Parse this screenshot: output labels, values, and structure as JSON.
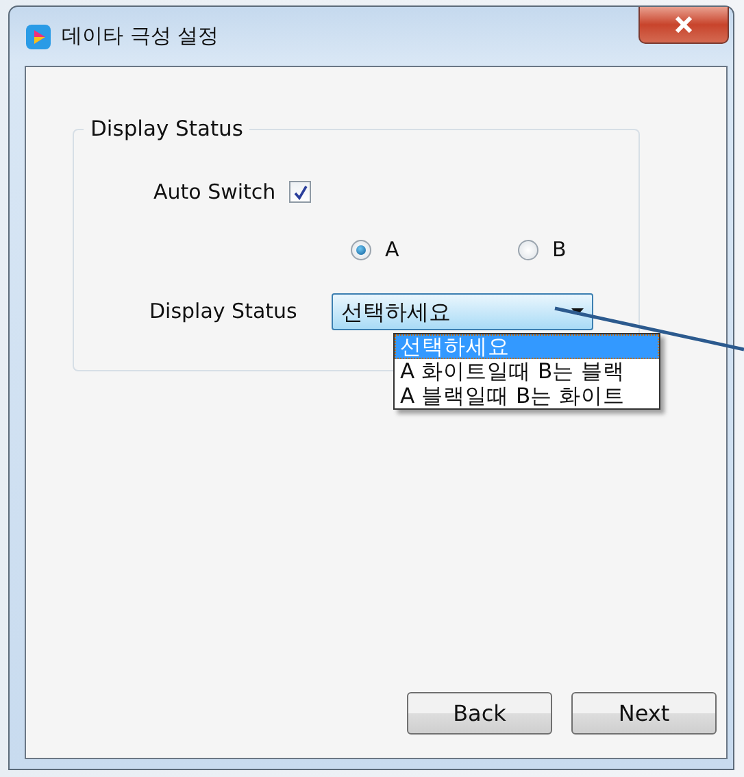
{
  "window": {
    "title": "데이타 극성 설정"
  },
  "group": {
    "title": "Display Status"
  },
  "auto_switch": {
    "label": "Auto Switch",
    "checked": true
  },
  "radios": [
    {
      "label": "A",
      "selected": true
    },
    {
      "label": "B",
      "selected": false
    }
  ],
  "dropdown": {
    "label": "Display Status",
    "value": "선택하세요",
    "expanded": true,
    "options": [
      {
        "label": "선택하세요",
        "selected": true
      },
      {
        "label": "A 화이트일때 B는 블랙",
        "selected": false
      },
      {
        "label": "A 블랙일때 B는 화이트",
        "selected": false
      }
    ]
  },
  "buttons": [
    {
      "label": "Back"
    },
    {
      "label": "Next"
    }
  ]
}
